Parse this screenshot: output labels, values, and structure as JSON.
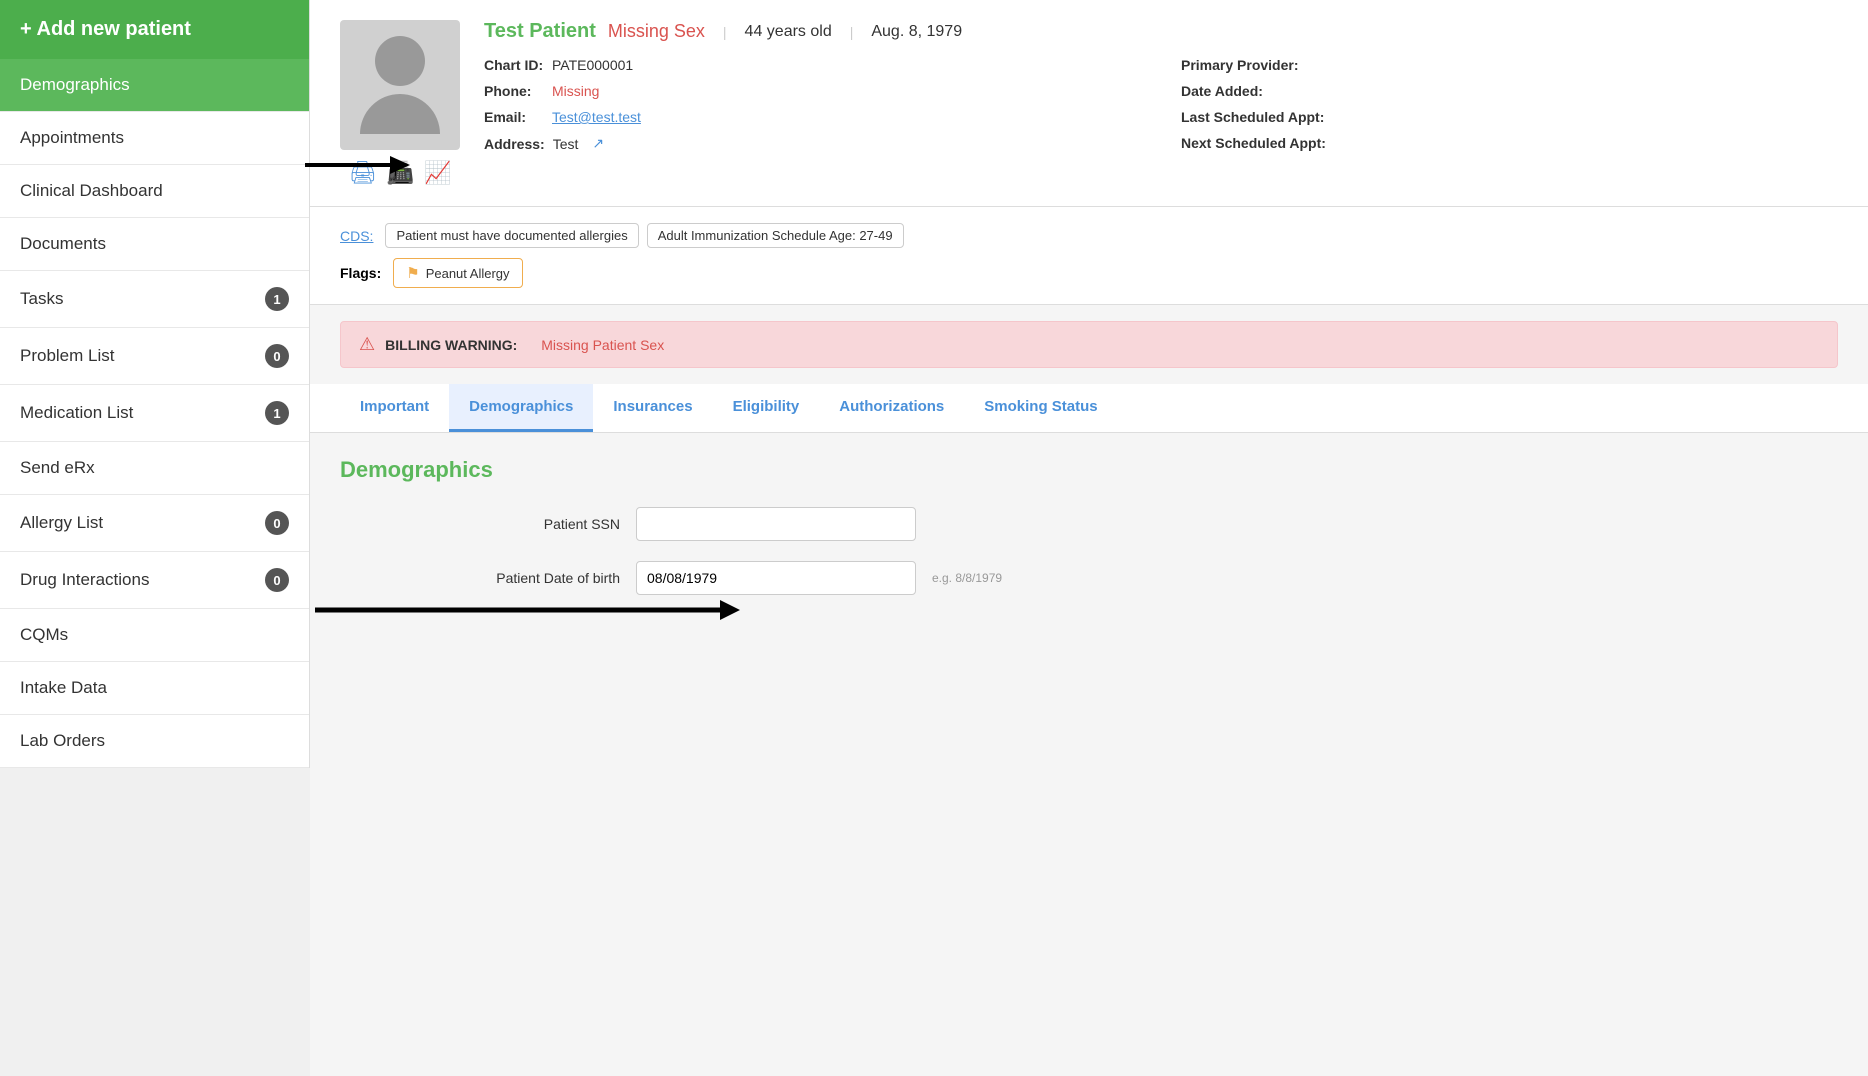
{
  "sidebar": {
    "add_patient_label": "+ Add new patient",
    "items": [
      {
        "label": "Demographics",
        "active": true,
        "badge": null
      },
      {
        "label": "Appointments",
        "active": false,
        "badge": null
      },
      {
        "label": "Clinical Dashboard",
        "active": false,
        "badge": null
      },
      {
        "label": "Documents",
        "active": false,
        "badge": null
      },
      {
        "label": "Tasks",
        "active": false,
        "badge": "1"
      },
      {
        "label": "Problem List",
        "active": false,
        "badge": "0"
      },
      {
        "label": "Medication List",
        "active": false,
        "badge": "1"
      },
      {
        "label": "Send eRx",
        "active": false,
        "badge": null
      },
      {
        "label": "Allergy List",
        "active": false,
        "badge": "0"
      },
      {
        "label": "Drug Interactions",
        "active": false,
        "badge": "0"
      },
      {
        "label": "CQMs",
        "active": false,
        "badge": null
      },
      {
        "label": "Intake Data",
        "active": false,
        "badge": null
      },
      {
        "label": "Lab Orders",
        "active": false,
        "badge": null
      }
    ]
  },
  "patient": {
    "name": "Test Patient",
    "missing_sex_label": "Missing Sex",
    "age": "44 years old",
    "dob": "Aug. 8, 1979",
    "chart_id_label": "Chart ID:",
    "chart_id_value": "PATE000001",
    "phone_label": "Phone:",
    "phone_value": "Missing",
    "email_label": "Email:",
    "email_value": "Test@test.test",
    "address_label": "Address:",
    "address_value": "Test",
    "primary_provider_label": "Primary Provider:",
    "primary_provider_value": "",
    "date_added_label": "Date Added:",
    "date_added_value": "",
    "last_appt_label": "Last Scheduled Appt:",
    "last_appt_value": "",
    "next_appt_label": "Next Scheduled Appt:",
    "next_appt_value": ""
  },
  "cds": {
    "link_label": "CDS:",
    "tags": [
      "Patient must have documented allergies",
      "Adult Immunization Schedule Age: 27-49"
    ]
  },
  "flags": {
    "label": "Flags:",
    "items": [
      "Peanut Allergy"
    ]
  },
  "billing_warning": {
    "strong": "BILLING WARNING:",
    "message": "Missing Patient Sex"
  },
  "tabs": [
    {
      "label": "Important",
      "active": false
    },
    {
      "label": "Demographics",
      "active": true
    },
    {
      "label": "Insurances",
      "active": false
    },
    {
      "label": "Eligibility",
      "active": false
    },
    {
      "label": "Authorizations",
      "active": false
    },
    {
      "label": "Smoking Status",
      "active": false
    }
  ],
  "demographics_section": {
    "title": "Demographics",
    "fields": [
      {
        "label": "Patient SSN",
        "value": "",
        "placeholder": "",
        "hint": ""
      },
      {
        "label": "Patient Date of birth",
        "value": "08/08/1979",
        "placeholder": "",
        "hint": "e.g. 8/8/1979"
      }
    ]
  }
}
